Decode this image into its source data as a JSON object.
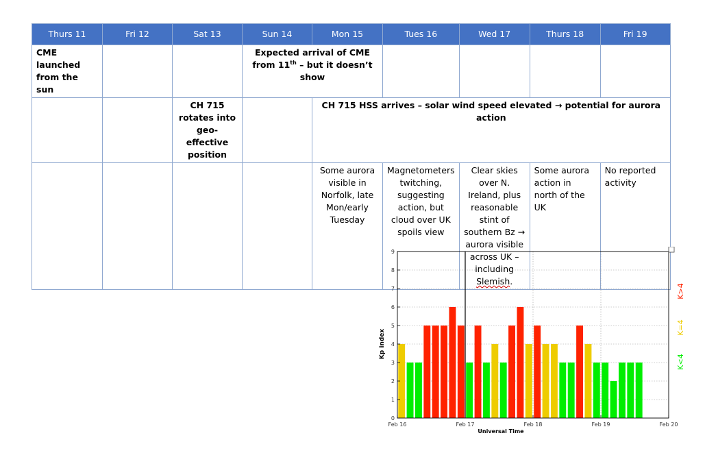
{
  "table": {
    "headers": [
      "Thurs 11",
      "Fri 12",
      "Sat 13",
      "Sun 14",
      "Mon 15",
      "Tues 16",
      "Wed 17",
      "Thurs 18",
      "Fri 19"
    ],
    "row1": {
      "thu11": "CME launched from the sun",
      "sun14_pre": "Expected arrival of CME from 11",
      "sun14_sup": "th",
      "sun14_post": " – but it doesn’t show"
    },
    "row2": {
      "sat13": "CH 715 rotates into geo-effective position",
      "span": "CH 715 HSS arrives – solar wind speed elevated → potential for aurora action"
    },
    "row3": {
      "mon15": "Some aurora visible in Norfolk, late Mon/early Tuesday",
      "tue16": "Magnetometers twitching, suggesting action, but cloud over UK spoils view",
      "wed17_pre": "Clear skies over N. Ireland, plus reasonable stint of southern Bz → aurora visible across UK – including ",
      "wed17_word": "Slemish",
      "wed17_post": ".",
      "thu18": "Some aurora action in north of the UK",
      "fri19": "No reported activity"
    }
  },
  "chart_data": {
    "type": "bar",
    "ylabel": "Kp index",
    "xlabel": "Universal Time",
    "ylim": [
      0,
      9
    ],
    "yticks": [
      0,
      1,
      2,
      3,
      4,
      5,
      6,
      7,
      8,
      9
    ],
    "xlim": [
      0,
      4
    ],
    "xticks": [
      {
        "pos": 0,
        "label": "Feb 16"
      },
      {
        "pos": 1,
        "label": "Feb 17"
      },
      {
        "pos": 2,
        "label": "Feb 18"
      },
      {
        "pos": 3,
        "label": "Feb 19"
      },
      {
        "pos": 4,
        "label": "Feb 20"
      }
    ],
    "bar_width_intervals": 0.125,
    "values": [
      4,
      3,
      3,
      5,
      5,
      5,
      6,
      5,
      3,
      5,
      3,
      4,
      3,
      5,
      6,
      4,
      5,
      4,
      4,
      3,
      3,
      5,
      4,
      3,
      3,
      2,
      3,
      3,
      3
    ],
    "legend": [
      {
        "label": "K<4",
        "color": "#00ee00"
      },
      {
        "label": "K=4",
        "color": "#eecc00"
      },
      {
        "label": "K>4",
        "color": "#ff2200"
      }
    ],
    "colors": {
      "low": "#00ee00",
      "mid": "#eecc00",
      "high": "#ff2200"
    }
  }
}
